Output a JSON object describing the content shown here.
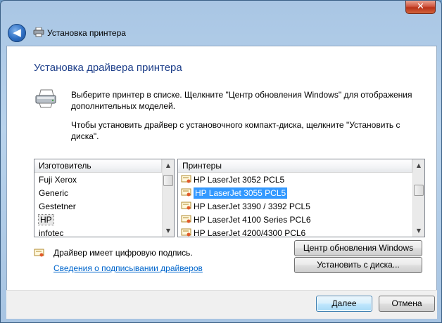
{
  "window": {
    "close_glyph": "✕",
    "back_glyph": "◀",
    "title": "Установка принтера"
  },
  "content": {
    "heading": "Установка драйвера принтера",
    "description_1": "Выберите принтер в списке. Щелкните \"Центр обновления Windows\" для отображения дополнительных моделей.",
    "description_2": "Чтобы установить драйвер с установочного компакт-диска, щелкните \"Установить с диска\"."
  },
  "manufacturers": {
    "header": "Изготовитель",
    "items": [
      "Fuji Xerox",
      "Generic",
      "Gestetner",
      "HP",
      "infotec"
    ],
    "selected": "HP"
  },
  "printers": {
    "header": "Принтеры",
    "items": [
      "HP LaserJet 3052 PCL5",
      "HP LaserJet 3055 PCL5",
      "HP LaserJet 3390 / 3392 PCL5",
      "HP LaserJet 4100 Series PCL6",
      "HP LaserJet 4200/4300 PCL6"
    ],
    "selected": "HP LaserJet 3055 PCL5"
  },
  "signature": {
    "text": "Драйвер имеет цифровую подпись.",
    "link": "Сведения о подписывании драйверов"
  },
  "buttons": {
    "windows_update": "Центр обновления Windows",
    "have_disk": "Установить с диска...",
    "next": "Далее",
    "cancel": "Отмена"
  },
  "scroll_glyphs": {
    "up": "▲",
    "down": "▼"
  },
  "colors": {
    "heading": "#1e3f8a",
    "selection": "#3399ff",
    "link": "#0066cc"
  }
}
